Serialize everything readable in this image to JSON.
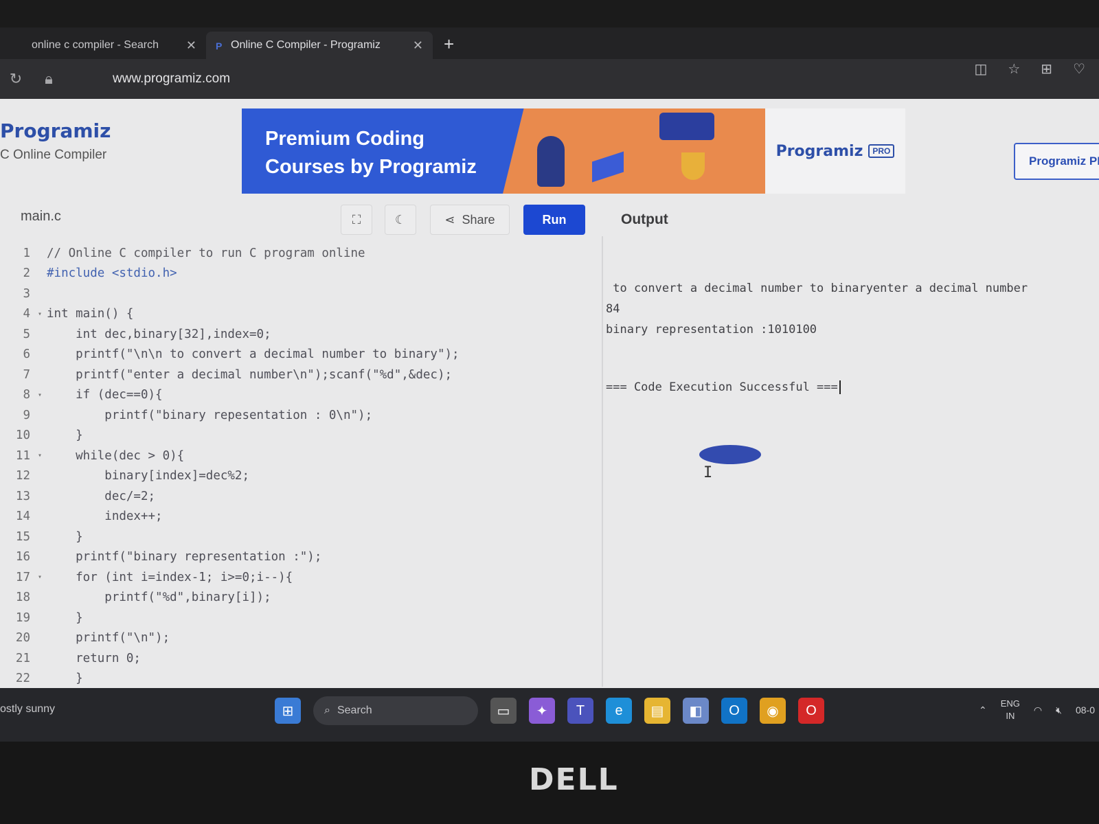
{
  "browser": {
    "tabs": [
      {
        "label": "online c compiler - Search",
        "active": false
      },
      {
        "label": "Online C Compiler - Programiz",
        "active": true
      }
    ],
    "new_tab_icon": "plus-icon",
    "url": "www.programiz.com"
  },
  "site": {
    "logo": "Programiz",
    "subtitle": "C Online Compiler",
    "banner_line1": "Premium Coding",
    "banner_line2": "Courses by Programiz",
    "ad_logo": "Programiz",
    "ad_badge": "PRO",
    "pro_button": "Programiz PRO"
  },
  "editor": {
    "filename": "main.c",
    "share_label": "Share",
    "run_label": "Run",
    "output_label": "Output",
    "lines": [
      {
        "n": "1",
        "fold": "",
        "code": "// Online C compiler to run C program online"
      },
      {
        "n": "2",
        "fold": "",
        "code": "#include <stdio.h>"
      },
      {
        "n": "3",
        "fold": "",
        "code": ""
      },
      {
        "n": "4",
        "fold": "▾",
        "code": "int main() {"
      },
      {
        "n": "5",
        "fold": "",
        "code": "    int dec,binary[32],index=0;"
      },
      {
        "n": "6",
        "fold": "",
        "code": "    printf(\"\\n\\n to convert a decimal number to binary\");"
      },
      {
        "n": "7",
        "fold": "",
        "code": "    printf(\"enter a decimal number\\n\");scanf(\"%d\",&dec);"
      },
      {
        "n": "8",
        "fold": "▾",
        "code": "    if (dec==0){"
      },
      {
        "n": "9",
        "fold": "",
        "code": "        printf(\"binary repesentation : 0\\n\");"
      },
      {
        "n": "10",
        "fold": "",
        "code": "    }"
      },
      {
        "n": "11",
        "fold": "▾",
        "code": "    while(dec > 0){"
      },
      {
        "n": "12",
        "fold": "",
        "code": "        binary[index]=dec%2;"
      },
      {
        "n": "13",
        "fold": "",
        "code": "        dec/=2;"
      },
      {
        "n": "14",
        "fold": "",
        "code": "        index++;"
      },
      {
        "n": "15",
        "fold": "",
        "code": "    }"
      },
      {
        "n": "16",
        "fold": "",
        "code": "    printf(\"binary representation :\");"
      },
      {
        "n": "17",
        "fold": "▾",
        "code": "    for (int i=index-1; i>=0;i--){"
      },
      {
        "n": "18",
        "fold": "",
        "code": "        printf(\"%d\",binary[i]);"
      },
      {
        "n": "19",
        "fold": "",
        "code": "    }"
      },
      {
        "n": "20",
        "fold": "",
        "code": "    printf(\"\\n\");"
      },
      {
        "n": "21",
        "fold": "",
        "code": "    return 0;"
      },
      {
        "n": "22",
        "fold": "",
        "code": "    }"
      }
    ]
  },
  "output": {
    "line1": " to convert a decimal number to binaryenter a decimal number",
    "line2": "84",
    "line3": "binary representation :1010100",
    "line4": "=== Code Execution Successful ==="
  },
  "taskbar": {
    "weather": "ostly sunny",
    "search_label": "Search",
    "lang_top": "ENG",
    "lang_bottom": "IN",
    "date_fragment": "08-0"
  },
  "bezel": {
    "brand": "DELL"
  }
}
